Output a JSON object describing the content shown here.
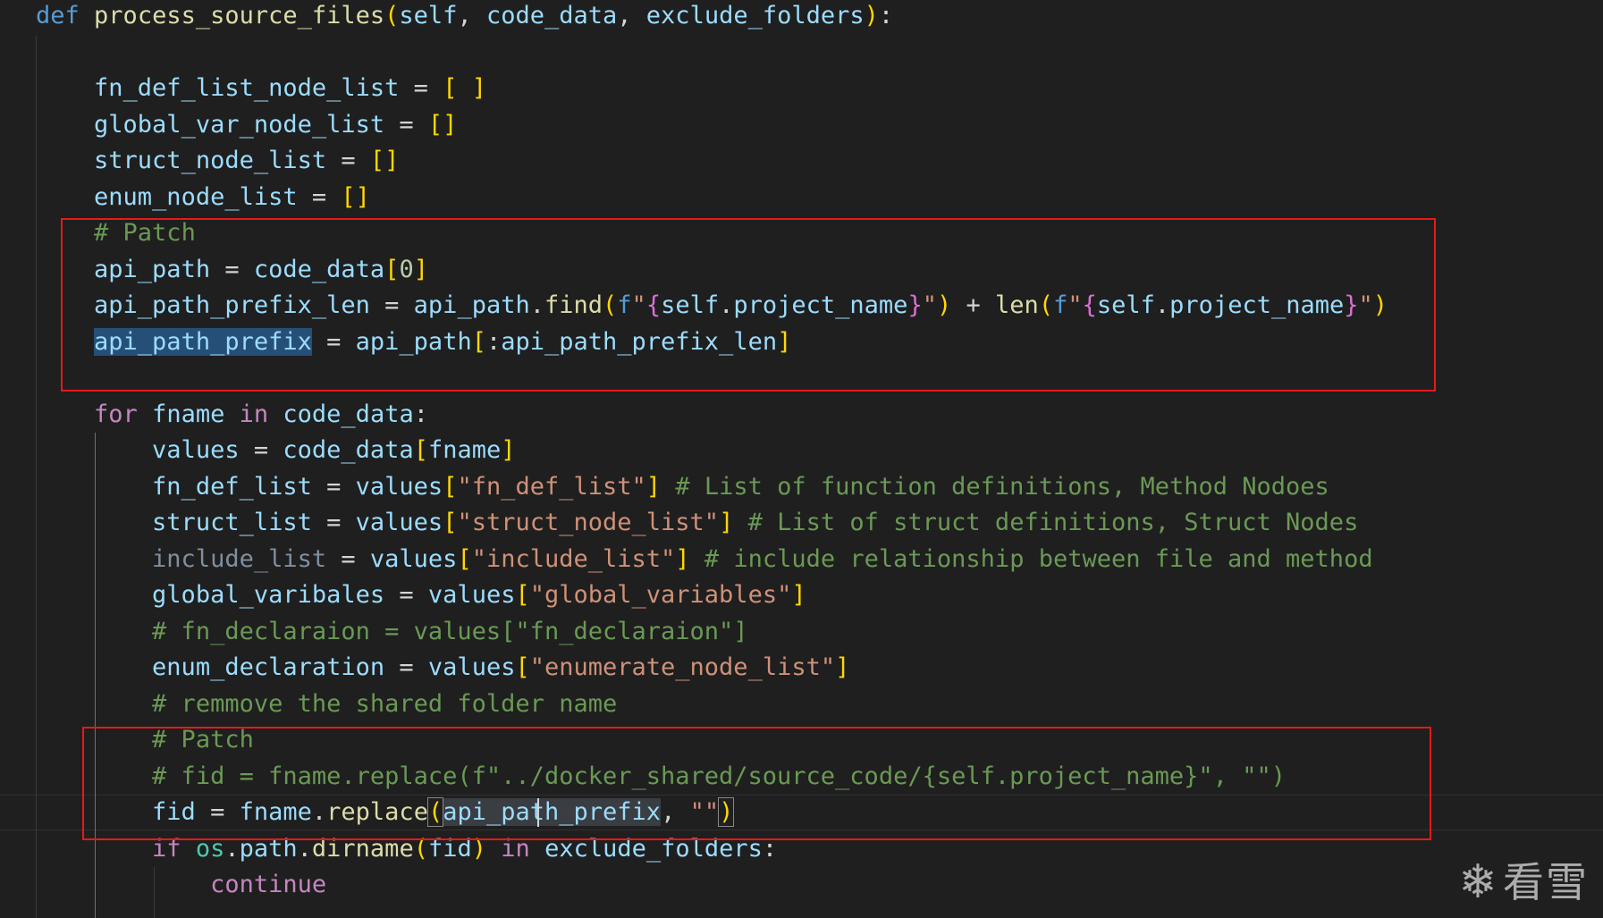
{
  "editor": {
    "lines": [
      {
        "tokens": [
          {
            "t": "def",
            "c": "kw"
          },
          {
            "t": " "
          },
          {
            "t": "process_source_files",
            "c": "fn"
          },
          {
            "t": "(",
            "c": "b1"
          },
          {
            "t": "self",
            "c": "var"
          },
          {
            "t": ", "
          },
          {
            "t": "code_data",
            "c": "var"
          },
          {
            "t": ", "
          },
          {
            "t": "exclude_folders",
            "c": "var"
          },
          {
            "t": ")",
            "c": "b1"
          },
          {
            "t": ":"
          }
        ]
      },
      {
        "tokens": []
      },
      {
        "tokens": [
          {
            "t": "    "
          },
          {
            "t": "fn_def_list_node_list",
            "c": "var"
          },
          {
            "t": " = "
          },
          {
            "t": "[ ]",
            "c": "b1"
          }
        ]
      },
      {
        "tokens": [
          {
            "t": "    "
          },
          {
            "t": "global_var_node_list",
            "c": "var"
          },
          {
            "t": " = "
          },
          {
            "t": "[]",
            "c": "b1"
          }
        ]
      },
      {
        "tokens": [
          {
            "t": "    "
          },
          {
            "t": "struct_node_list",
            "c": "var"
          },
          {
            "t": " = "
          },
          {
            "t": "[]",
            "c": "b1"
          }
        ]
      },
      {
        "tokens": [
          {
            "t": "    "
          },
          {
            "t": "enum_node_list",
            "c": "var"
          },
          {
            "t": " = "
          },
          {
            "t": "[]",
            "c": "b1"
          }
        ]
      },
      {
        "tokens": [
          {
            "t": "    "
          },
          {
            "t": "# Patch",
            "c": "cmt"
          }
        ]
      },
      {
        "tokens": [
          {
            "t": "    "
          },
          {
            "t": "api_path",
            "c": "var"
          },
          {
            "t": " = "
          },
          {
            "t": "code_data",
            "c": "var"
          },
          {
            "t": "[",
            "c": "b1"
          },
          {
            "t": "0",
            "c": "num"
          },
          {
            "t": "]",
            "c": "b1"
          }
        ]
      },
      {
        "tokens": [
          {
            "t": "    "
          },
          {
            "t": "api_path_prefix_len",
            "c": "var"
          },
          {
            "t": " = "
          },
          {
            "t": "api_path",
            "c": "var"
          },
          {
            "t": "."
          },
          {
            "t": "find",
            "c": "fn"
          },
          {
            "t": "(",
            "c": "b1"
          },
          {
            "t": "f",
            "c": "kw"
          },
          {
            "t": "\"",
            "c": "str"
          },
          {
            "t": "{",
            "c": "b2"
          },
          {
            "t": "self",
            "c": "var"
          },
          {
            "t": "."
          },
          {
            "t": "project_name",
            "c": "var"
          },
          {
            "t": "}",
            "c": "b2"
          },
          {
            "t": "\"",
            "c": "str"
          },
          {
            "t": ")",
            "c": "b1"
          },
          {
            "t": " + "
          },
          {
            "t": "len",
            "c": "fn"
          },
          {
            "t": "(",
            "c": "b1"
          },
          {
            "t": "f",
            "c": "kw"
          },
          {
            "t": "\"",
            "c": "str"
          },
          {
            "t": "{",
            "c": "b2"
          },
          {
            "t": "self",
            "c": "var"
          },
          {
            "t": "."
          },
          {
            "t": "project_name",
            "c": "var"
          },
          {
            "t": "}",
            "c": "b2"
          },
          {
            "t": "\"",
            "c": "str"
          },
          {
            "t": ")",
            "c": "b1"
          }
        ]
      },
      {
        "tokens": [
          {
            "t": "    "
          },
          {
            "t": "api_path_prefix",
            "c": "var hl"
          },
          {
            "t": " = "
          },
          {
            "t": "api_path",
            "c": "var"
          },
          {
            "t": "[",
            "c": "b1"
          },
          {
            "t": ":"
          },
          {
            "t": "api_path_prefix_len",
            "c": "var"
          },
          {
            "t": "]",
            "c": "b1"
          }
        ]
      },
      {
        "tokens": []
      },
      {
        "tokens": [
          {
            "t": "    "
          },
          {
            "t": "for",
            "c": "kwc"
          },
          {
            "t": " "
          },
          {
            "t": "fname",
            "c": "var"
          },
          {
            "t": " "
          },
          {
            "t": "in",
            "c": "kwc"
          },
          {
            "t": " "
          },
          {
            "t": "code_data",
            "c": "var"
          },
          {
            "t": ":"
          }
        ]
      },
      {
        "tokens": [
          {
            "t": "        "
          },
          {
            "t": "values",
            "c": "var"
          },
          {
            "t": " = "
          },
          {
            "t": "code_data",
            "c": "var"
          },
          {
            "t": "[",
            "c": "b1"
          },
          {
            "t": "fname",
            "c": "var"
          },
          {
            "t": "]",
            "c": "b1"
          }
        ]
      },
      {
        "tokens": [
          {
            "t": "        "
          },
          {
            "t": "fn_def_list",
            "c": "var"
          },
          {
            "t": " = "
          },
          {
            "t": "values",
            "c": "var"
          },
          {
            "t": "[",
            "c": "b1"
          },
          {
            "t": "\"fn_def_list\"",
            "c": "str"
          },
          {
            "t": "]",
            "c": "b1"
          },
          {
            "t": " "
          },
          {
            "t": "# List of function definitions, Method Nodoes",
            "c": "cmt"
          }
        ]
      },
      {
        "tokens": [
          {
            "t": "        "
          },
          {
            "t": "struct_list",
            "c": "var"
          },
          {
            "t": " = "
          },
          {
            "t": "values",
            "c": "var"
          },
          {
            "t": "[",
            "c": "b1"
          },
          {
            "t": "\"struct_node_list\"",
            "c": "str"
          },
          {
            "t": "]",
            "c": "b1"
          },
          {
            "t": " "
          },
          {
            "t": "# List of struct definitions, Struct Nodes",
            "c": "cmt"
          }
        ]
      },
      {
        "tokens": [
          {
            "t": "        "
          },
          {
            "t": "include_list",
            "c": "dim"
          },
          {
            "t": " = "
          },
          {
            "t": "values",
            "c": "var"
          },
          {
            "t": "[",
            "c": "b1"
          },
          {
            "t": "\"include_list\"",
            "c": "str"
          },
          {
            "t": "]",
            "c": "b1"
          },
          {
            "t": " "
          },
          {
            "t": "# include relationship between file and method",
            "c": "cmt"
          }
        ]
      },
      {
        "tokens": [
          {
            "t": "        "
          },
          {
            "t": "global_varibales",
            "c": "var"
          },
          {
            "t": " = "
          },
          {
            "t": "values",
            "c": "var"
          },
          {
            "t": "[",
            "c": "b1"
          },
          {
            "t": "\"global_variables\"",
            "c": "str"
          },
          {
            "t": "]",
            "c": "b1"
          }
        ]
      },
      {
        "tokens": [
          {
            "t": "        "
          },
          {
            "t": "# fn_declaraion = values[\"fn_declaraion\"]",
            "c": "cmt"
          }
        ]
      },
      {
        "tokens": [
          {
            "t": "        "
          },
          {
            "t": "enum_declaration",
            "c": "var"
          },
          {
            "t": " = "
          },
          {
            "t": "values",
            "c": "var"
          },
          {
            "t": "[",
            "c": "b1"
          },
          {
            "t": "\"enumerate_node_list\"",
            "c": "str"
          },
          {
            "t": "]",
            "c": "b1"
          }
        ]
      },
      {
        "tokens": [
          {
            "t": "        "
          },
          {
            "t": "# remmove the shared folder name",
            "c": "cmt"
          }
        ]
      },
      {
        "tokens": [
          {
            "t": "        "
          },
          {
            "t": "# Patch",
            "c": "cmt"
          }
        ]
      },
      {
        "tokens": [
          {
            "t": "        "
          },
          {
            "t": "# fid = fname.replace(f\"../docker_shared/source_code/{self.project_name}\", \"\")",
            "c": "cmt"
          }
        ]
      },
      {
        "tokens": [
          {
            "t": "        "
          },
          {
            "t": "fid",
            "c": "var"
          },
          {
            "t": " = "
          },
          {
            "t": "fname",
            "c": "var"
          },
          {
            "t": "."
          },
          {
            "t": "replace",
            "c": "fn"
          },
          {
            "t": "(",
            "c": "b1 bm"
          },
          {
            "t": "api_path_prefix",
            "c": "var hl2"
          },
          {
            "t": ", "
          },
          {
            "t": "\"\"",
            "c": "str"
          },
          {
            "t": ")",
            "c": "b1 bm"
          }
        ]
      },
      {
        "tokens": [
          {
            "t": "        "
          },
          {
            "t": "if",
            "c": "kwc"
          },
          {
            "t": " "
          },
          {
            "t": "os",
            "c": "mod"
          },
          {
            "t": "."
          },
          {
            "t": "path",
            "c": "var"
          },
          {
            "t": "."
          },
          {
            "t": "dirname",
            "c": "fn"
          },
          {
            "t": "(",
            "c": "b1"
          },
          {
            "t": "fid",
            "c": "var"
          },
          {
            "t": ")",
            "c": "b1"
          },
          {
            "t": " "
          },
          {
            "t": "in",
            "c": "kwc"
          },
          {
            "t": " "
          },
          {
            "t": "exclude_folders",
            "c": "var"
          },
          {
            "t": ":"
          }
        ]
      },
      {
        "tokens": [
          {
            "t": "            "
          },
          {
            "t": "continue",
            "c": "kwc"
          }
        ]
      }
    ]
  },
  "watermark": {
    "icon": "snowflake-icon",
    "icon_glyph": "❄",
    "text": "看雪"
  },
  "colors": {
    "background": "#1f1f1f",
    "highlight_box": "#e51a1a",
    "keyword": "#569cd6",
    "control_keyword": "#c586c0",
    "function": "#dcdcaa",
    "variable": "#9cdcfe",
    "string": "#ce9178",
    "comment": "#6a9955",
    "bracket": "#ffd700"
  }
}
